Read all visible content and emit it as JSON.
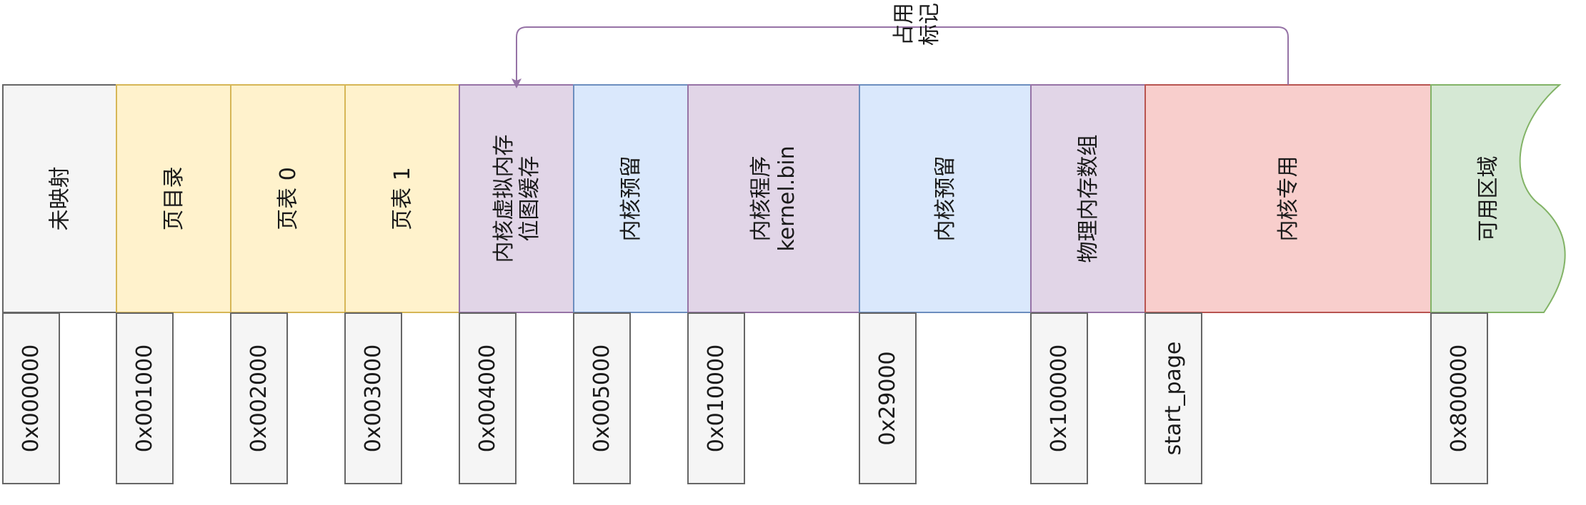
{
  "diagram": {
    "arrow": {
      "label_lines": [
        "占用",
        "标记"
      ],
      "color": "#9673a6"
    },
    "segments": [
      {
        "lines": [
          "未映射"
        ],
        "fill": "#f5f5f5",
        "stroke": "#666666"
      },
      {
        "lines": [
          "页目录"
        ],
        "fill": "#fff2cc",
        "stroke": "#d6b656"
      },
      {
        "lines": [
          "页表 0"
        ],
        "fill": "#fff2cc",
        "stroke": "#d6b656"
      },
      {
        "lines": [
          "页表 1"
        ],
        "fill": "#fff2cc",
        "stroke": "#d6b656"
      },
      {
        "lines": [
          "内核虚拟内存",
          "位图缓存"
        ],
        "fill": "#e1d5e7",
        "stroke": "#9673a6"
      },
      {
        "lines": [
          "内核预留"
        ],
        "fill": "#dae8fc",
        "stroke": "#6c8ebf"
      },
      {
        "lines": [
          "内核程序",
          "kernel.bin"
        ],
        "fill": "#e1d5e7",
        "stroke": "#9673a6"
      },
      {
        "lines": [
          "内核预留"
        ],
        "fill": "#dae8fc",
        "stroke": "#6c8ebf"
      },
      {
        "lines": [
          "物理内存数组"
        ],
        "fill": "#e1d5e7",
        "stroke": "#9673a6"
      },
      {
        "lines": [
          "内核专用"
        ],
        "fill": "#f8cecc",
        "stroke": "#b85450"
      },
      {
        "lines": [
          "可用区域"
        ],
        "fill": "#d5e8d4",
        "stroke": "#82b366"
      }
    ],
    "addresses": [
      "0x000000",
      "0x001000",
      "0x002000",
      "0x003000",
      "0x004000",
      "0x005000",
      "0x010000",
      "0x29000",
      "0x100000",
      "start_page",
      "0x800000"
    ],
    "address_fill": "#f5f5f5",
    "address_stroke": "#666666"
  }
}
